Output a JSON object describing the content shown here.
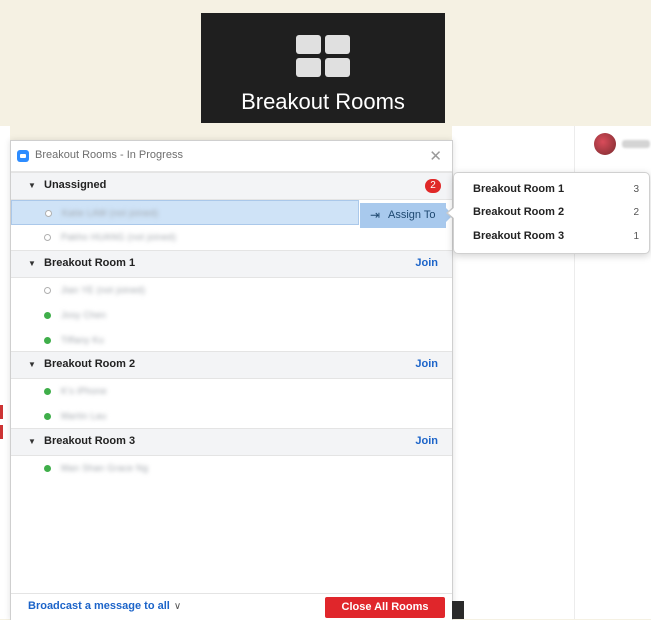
{
  "toolbar_button": {
    "label": "Breakout Rooms",
    "icon": "grid-icon"
  },
  "window": {
    "title": "Breakout Rooms - In Progress",
    "close_glyph": "✕"
  },
  "groups": [
    {
      "name": "Unassigned",
      "badge": "2",
      "members": [
        {
          "name": "Katie LAW (not joined)",
          "status": "offline",
          "selected": true
        },
        {
          "name": "Pakho HUANG (not joined)",
          "status": "offline",
          "selected": false
        }
      ]
    },
    {
      "name": "Breakout Room 1",
      "action": "Join",
      "members": [
        {
          "name": "Jian YE (not joined)",
          "status": "offline"
        },
        {
          "name": "Josy Chen",
          "status": "online"
        },
        {
          "name": "Tiffany Ku",
          "status": "online"
        }
      ]
    },
    {
      "name": "Breakout Room 2",
      "action": "Join",
      "members": [
        {
          "name": "K's iPhone",
          "status": "online"
        },
        {
          "name": "Martin Lau",
          "status": "online"
        }
      ]
    },
    {
      "name": "Breakout Room 3",
      "action": "Join",
      "members": [
        {
          "name": "Man Shan Grace Ng",
          "status": "online"
        }
      ]
    }
  ],
  "assign_button": {
    "label": "Assign To",
    "icon_glyph": "⇥"
  },
  "popup": {
    "items": [
      {
        "room": "Breakout Room 1",
        "count": "3"
      },
      {
        "room": "Breakout Room 2",
        "count": "2"
      },
      {
        "room": "Breakout Room 3",
        "count": "1"
      }
    ]
  },
  "footer": {
    "broadcast_label": "Broadcast a message to all",
    "chevron": "∨",
    "close_all_label": "Close All Rooms"
  },
  "colors": {
    "accent": "#1c64c9",
    "danger": "#e02828",
    "online": "#3fae4a",
    "selected_row": "#cfe3f7"
  }
}
